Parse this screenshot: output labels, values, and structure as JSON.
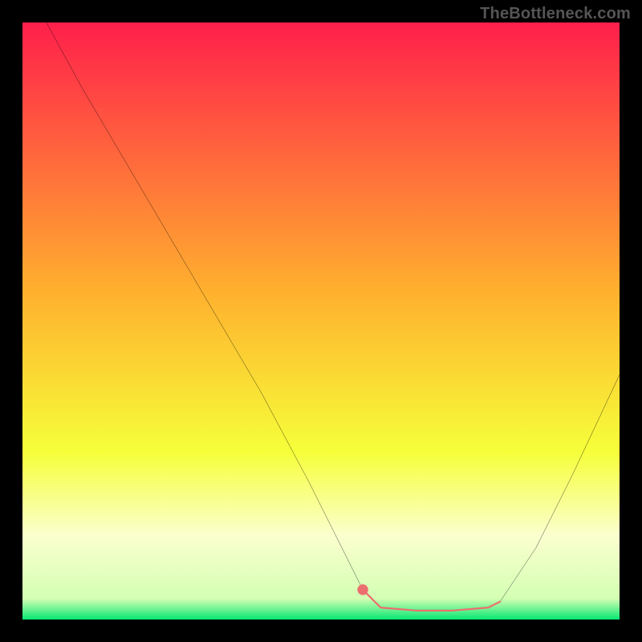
{
  "watermark": "TheBottleneck.com",
  "colors": {
    "frame": "#000000",
    "curve": "#000000",
    "highlight": "#ec6e6e",
    "highlight_dot": "#ec6e6e",
    "gradient_top": "#ff1f4b",
    "gradient_mid1": "#ffb02e",
    "gradient_mid2": "#f6ff3a",
    "gradient_band": "#fbffcf",
    "gradient_bottom": "#06e772"
  },
  "chart_data": {
    "type": "line",
    "title": "",
    "xlabel": "",
    "ylabel": "",
    "xlim": [
      0,
      100
    ],
    "ylim": [
      0,
      100
    ],
    "grid": false,
    "legend": false,
    "series": [
      {
        "name": "bottleneck-curve",
        "x": [
          4,
          10,
          20,
          30,
          40,
          48,
          54,
          57,
          60,
          66,
          72,
          78,
          80,
          86,
          92,
          100
        ],
        "y": [
          100,
          89,
          72,
          55,
          38,
          23,
          11,
          5,
          2,
          1.5,
          1.5,
          2,
          3,
          12,
          24,
          41
        ]
      },
      {
        "name": "optimal-range-highlight",
        "x": [
          57,
          60,
          66,
          72,
          78,
          80
        ],
        "y": [
          5,
          2,
          1.5,
          1.5,
          2,
          3
        ]
      }
    ],
    "annotations": [
      {
        "name": "optimal-start-dot",
        "x": 57,
        "y": 5
      }
    ],
    "background_gradient_stops": [
      {
        "offset": 0.0,
        "color": "#ff1f4b"
      },
      {
        "offset": 0.45,
        "color": "#ffb02e"
      },
      {
        "offset": 0.72,
        "color": "#f6ff3a"
      },
      {
        "offset": 0.86,
        "color": "#fbffcf"
      },
      {
        "offset": 0.965,
        "color": "#d4ffb3"
      },
      {
        "offset": 1.0,
        "color": "#06e772"
      }
    ]
  }
}
